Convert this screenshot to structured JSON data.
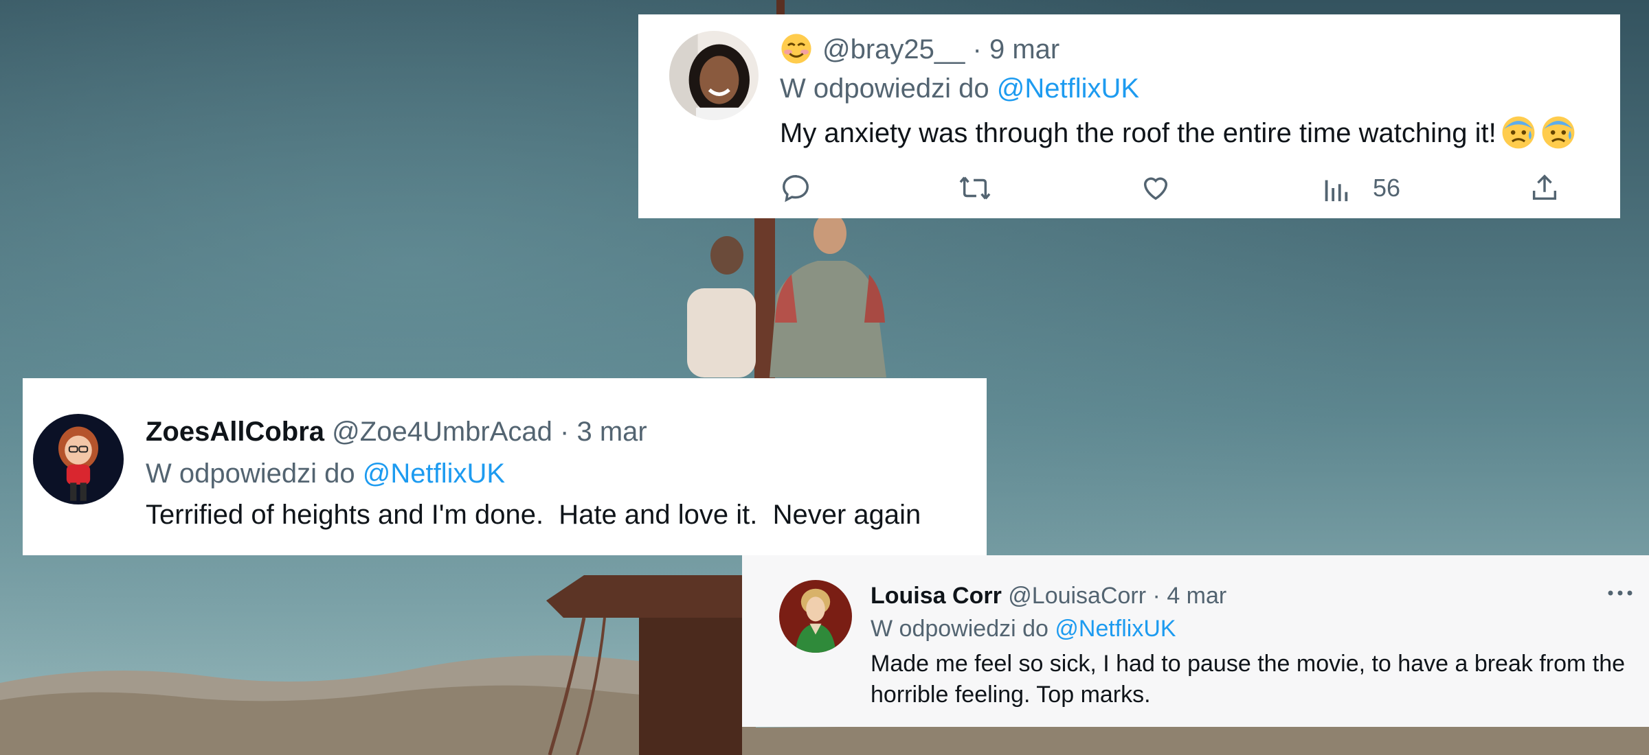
{
  "tweets": [
    {
      "display_name": "",
      "handle": "@bray25__",
      "date": "9 mar",
      "reply_prefix": "W odpowiedzi do",
      "reply_to": "@NetflixUK",
      "text": "My anxiety was through the roof the entire time watching it!",
      "views": "56",
      "name_emoji": "smiling-face-icon",
      "trailing_emoji": [
        "anxious-face-with-sweat-icon",
        "anxious-face-with-sweat-icon"
      ]
    },
    {
      "display_name": "ZoesAllCobra",
      "handle": "@Zoe4UmbrAcad",
      "date": "3 mar",
      "reply_prefix": "W odpowiedzi do",
      "reply_to": "@NetflixUK",
      "text": "Terrified of heights and I'm done.  Hate and love it.  Never again"
    },
    {
      "display_name": "Louisa Corr",
      "handle": "@LouisaCorr",
      "date": "4 mar",
      "reply_prefix": "W odpowiedzi do",
      "reply_to": "@NetflixUK",
      "text": "Made me feel so sick, I had to pause the movie, to have a break from the horrible feeling. Top marks."
    }
  ],
  "separator": "·",
  "colors": {
    "text": "#0f1419",
    "secondary": "#536471",
    "mention": "#1d9bf0",
    "sky_top": "#34535f",
    "sky_bottom": "#8fb3b8"
  }
}
